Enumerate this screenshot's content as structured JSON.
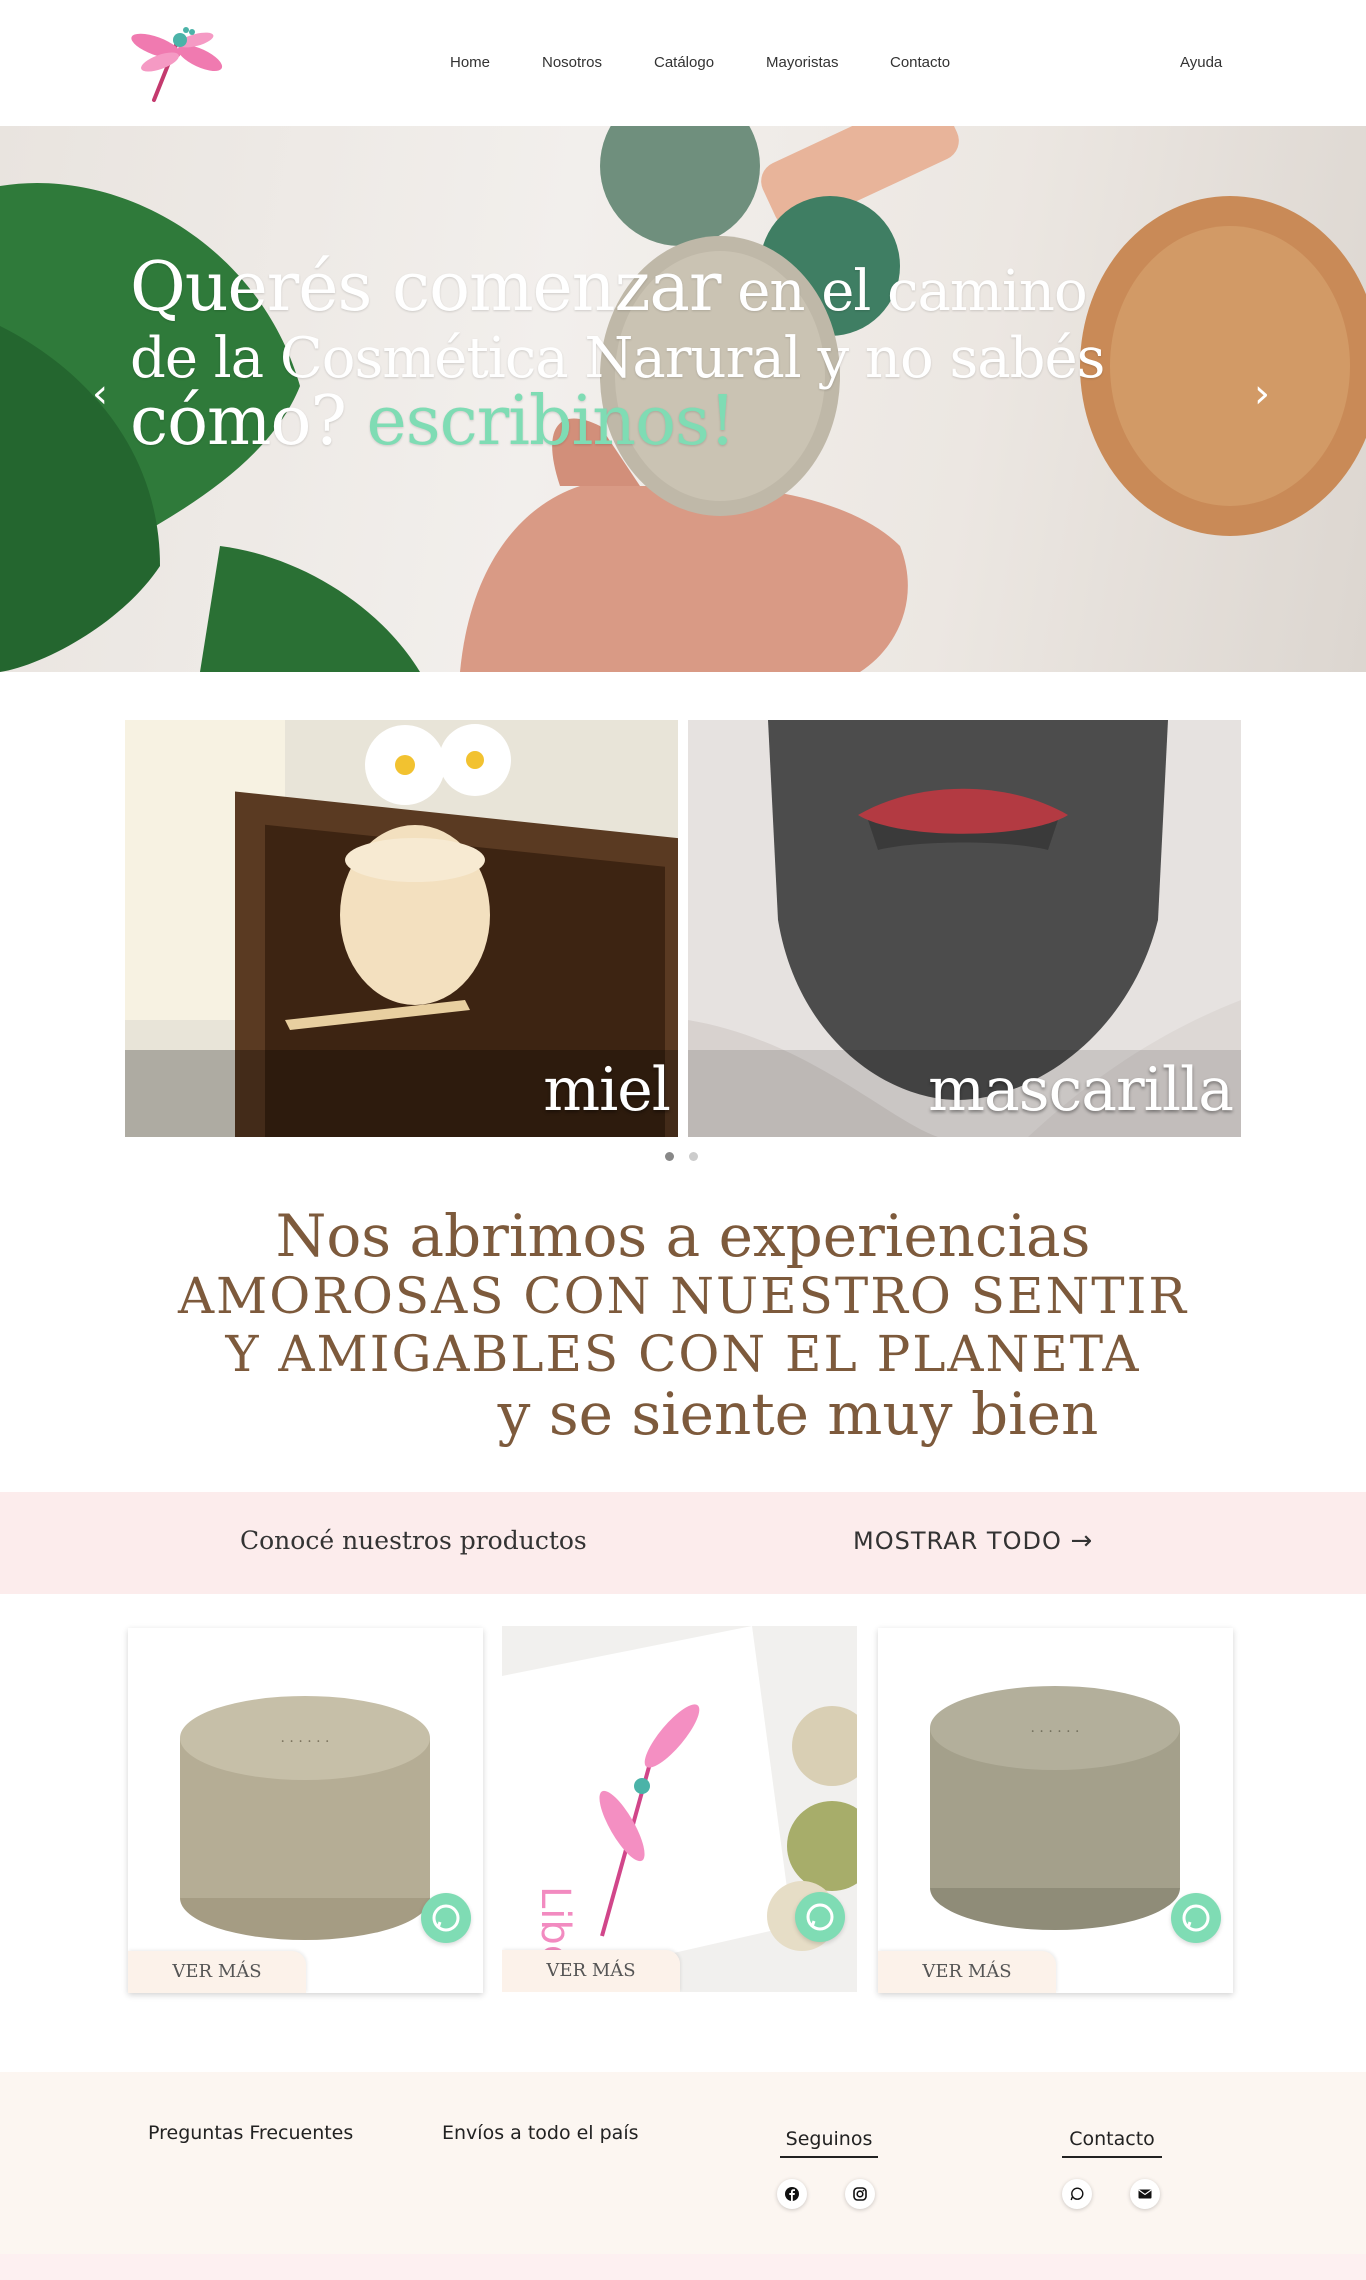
{
  "header": {
    "nav": [
      "Home",
      "Nosotros",
      "Catálogo",
      "Mayoristas",
      "Contacto"
    ],
    "help": "Ayuda"
  },
  "hero": {
    "line1_big": "Querés comenzar",
    "line1_small": " en el camino",
    "line2": "de la Cosmética Narural y no sabés",
    "line3": "cómo? ",
    "line3_accent": "escribinos!",
    "prev_icon": "chevron-left-icon",
    "next_icon": "chevron-right-icon"
  },
  "categories": [
    {
      "label": "miel"
    },
    {
      "label": "mascarilla"
    }
  ],
  "tagline": {
    "line1": "Nos abrimos a experiencias",
    "line2": "AMOROSAS CON NUESTRO SENTIR",
    "line3": "Y AMIGABLES CON EL PLANETA",
    "line4": "y se siente muy bien"
  },
  "products_band": {
    "title": "Conocé nuestros productos",
    "show_all": "MOSTRAR TODO"
  },
  "products": [
    {
      "button": "VER MÁS"
    },
    {
      "button": "VER MÁS"
    },
    {
      "button": "VER MÁS"
    }
  ],
  "footer": {
    "faq": "Preguntas Frecuentes",
    "shipping": "Envíos a todo el país",
    "follow_title": "Seguinos",
    "contact_title": "Contacto",
    "follow_icons": [
      "facebook-icon",
      "instagram-icon"
    ],
    "contact_icons": [
      "whatsapp-icon",
      "envelope-icon"
    ]
  },
  "colors": {
    "accent_green": "#7fdcb4",
    "brown_text": "#7d5a3c",
    "band_pink": "#fcecec",
    "footer_bg": "#fcf6f1"
  }
}
